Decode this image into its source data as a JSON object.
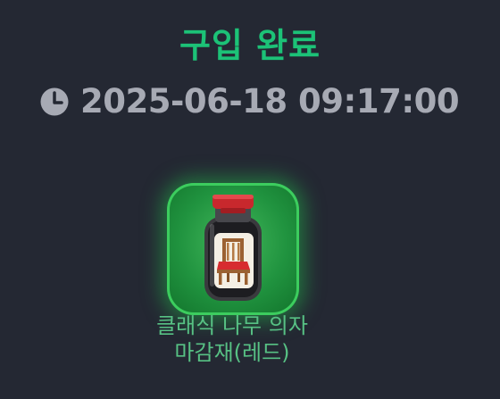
{
  "header": {
    "title": "구입 완료"
  },
  "purchase": {
    "timestamp": "2025-06-18 09:17:00",
    "clock_icon": "clock-icon"
  },
  "item": {
    "icon": "chair-in-bottle-icon",
    "name_line1": "클래식 나무 의자",
    "name_line2": "마감재(레드)"
  },
  "colors": {
    "background": "#242833",
    "title": "#1cc277",
    "timestamp": "#a7aab4",
    "item_name": "#57c184",
    "item_frame": "#20933f"
  }
}
